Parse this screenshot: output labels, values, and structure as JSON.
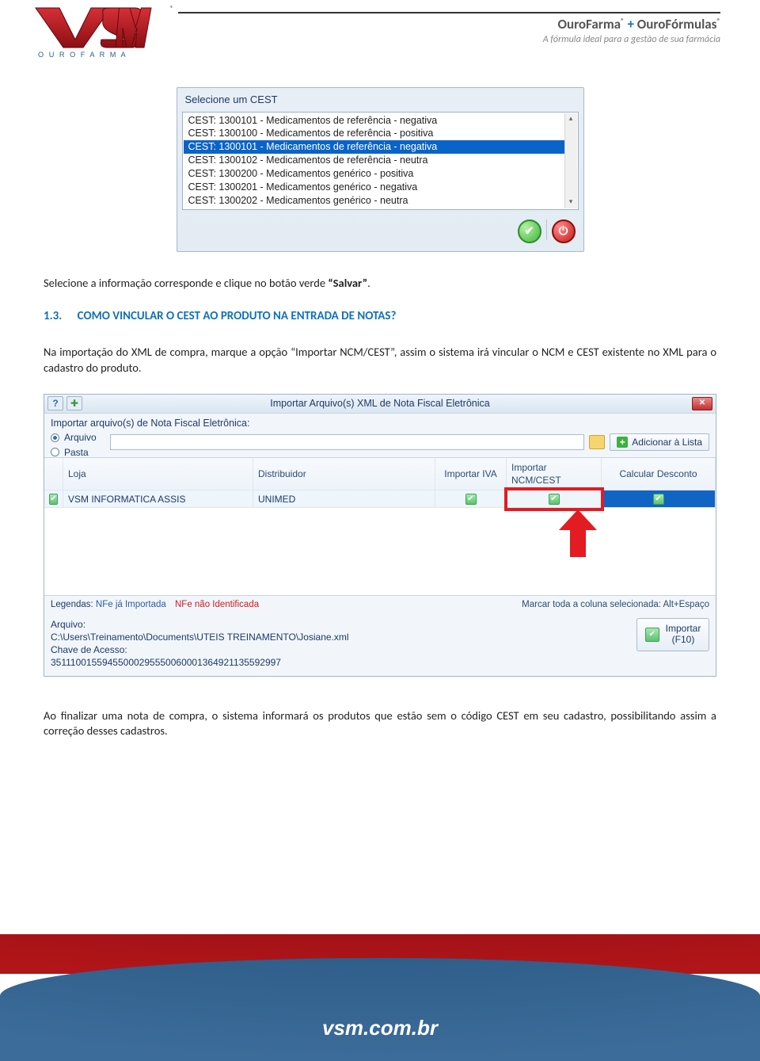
{
  "header": {
    "logo_sub": "O U R O F A R M A",
    "brand_a": "OuroFarma",
    "brand_plus": " + ",
    "brand_b": "OuroFórmulas",
    "reg": "®",
    "tagline": "A fórmula ideal para a gestão de sua farmácia"
  },
  "cest_dialog": {
    "title": "Selecione um CEST",
    "items": [
      "CEST: 1300101 -  Medicamentos de referência - negativa",
      "CEST: 1300100 -  Medicamentos de referência - positiva",
      "CEST: 1300101 -  Medicamentos de referência - negativa",
      "CEST: 1300102 -  Medicamentos de referência - neutra",
      "CEST: 1300200 -  Medicamentos genérico - positiva",
      "CEST: 1300201 -  Medicamentos genérico - negativa",
      "CEST: 1300202 -  Medicamentos genérico - neutra"
    ],
    "selected_index": 2
  },
  "body": {
    "p1_a": "Selecione a informação corresponde e clique no botão verde ",
    "p1_b": "“Salvar”",
    "p1_c": ".",
    "heading_num": "1.3.",
    "heading_txt": "COMO VINCULAR O CEST AO PRODUTO NA ENTRADA DE NOTAS?",
    "p2": "Na importação do XML de compra, marque a opção “Importar NCM/CEST”, assim o sistema irá vincular o NCM e CEST existente no XML para o cadastro do produto.",
    "p3": "Ao finalizar uma nota de compra, o sistema informará os produtos que estão sem o código CEST em seu cadastro, possibilitando assim a correção desses cadastros."
  },
  "import_dialog": {
    "title": "Importar Arquivo(s) XML de Nota Fiscal Eletrônica",
    "main_label": "Importar arquivo(s) de Nota Fiscal Eletrônica:",
    "radio_arquivo": "Arquivo",
    "radio_pasta": "Pasta",
    "btn_add": "Adicionar à Lista",
    "cols": {
      "loja": "Loja",
      "dist": "Distribuidor",
      "iva": "Importar IVA",
      "ncm": "Importar NCM/CEST",
      "desc": "Calcular Desconto"
    },
    "row": {
      "loja": "VSM INFORMATICA ASSIS",
      "dist": "UNIMED"
    },
    "legend_label": "Legendas:",
    "legend_imported": "NFe já Importada",
    "legend_unknown": "NFe não Identificada",
    "legend_hint": "Marcar toda a coluna selecionada: Alt+Espaço",
    "file_label": "Arquivo:",
    "file_path": "C:\\Users\\Treinamento\\Documents\\UTEIS TREINAMENTO\\Josiane.xml",
    "key_label": "Chave de Acesso:",
    "key_value": "35111001559455000295550060001364921135592997",
    "btn_import_line1": "Importar",
    "btn_import_line2": "(F10)"
  },
  "footer": {
    "url": "vsm.com.br"
  }
}
